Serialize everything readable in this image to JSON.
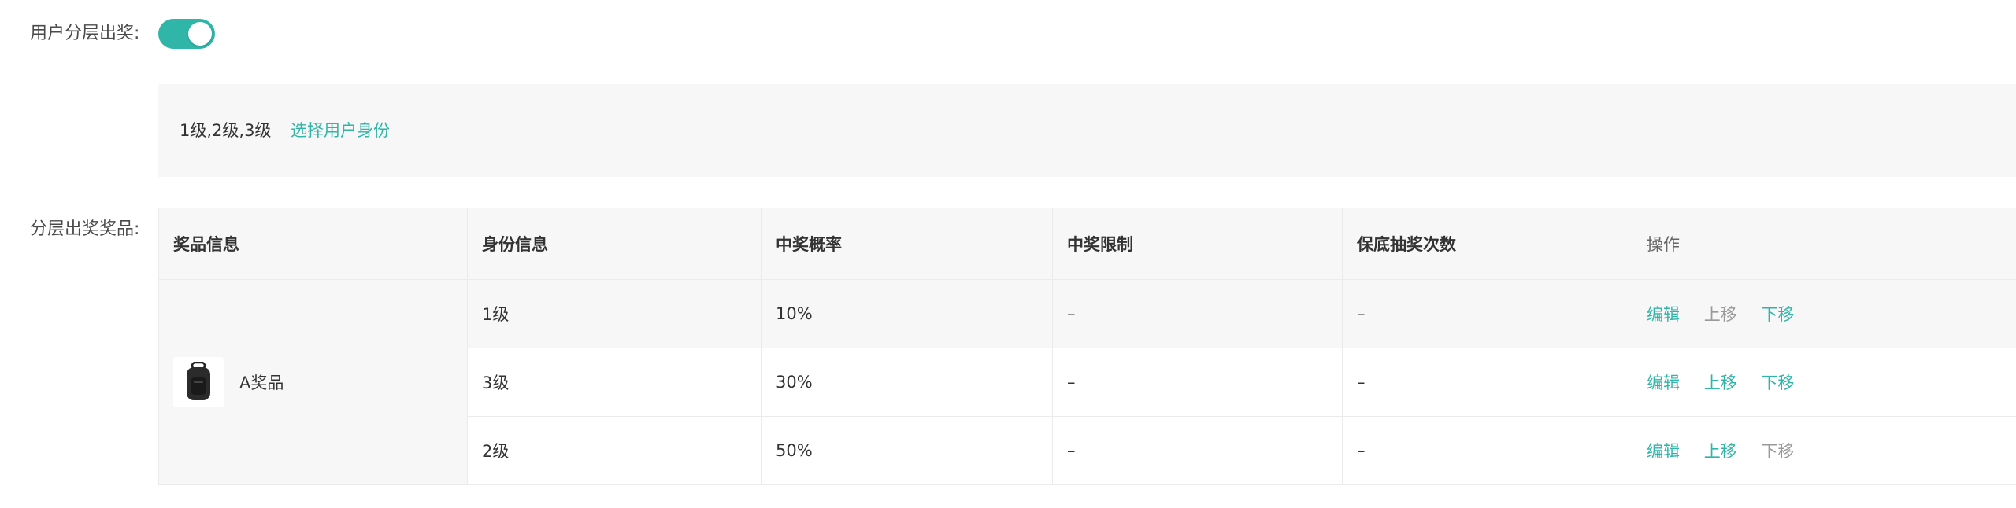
{
  "tiered_prize": {
    "label": "用户分层出奖:",
    "enabled": true
  },
  "identity": {
    "selected_values": "1级,2级,3级",
    "select_link": "选择用户身份"
  },
  "prize_section": {
    "label": "分层出奖奖品:",
    "columns": [
      "奖品信息",
      "身份信息",
      "中奖概率",
      "中奖限制",
      "保底抽奖次数",
      "操作"
    ],
    "prize_name": "A奖品",
    "prize_icon": "backpack-icon",
    "rows": [
      {
        "identity": "1级",
        "probability": "10%",
        "limit": "–",
        "guarantee": "–",
        "actions": [
          {
            "label": "编辑",
            "enabled": true
          },
          {
            "label": "上移",
            "enabled": false
          },
          {
            "label": "下移",
            "enabled": true
          }
        ]
      },
      {
        "identity": "3级",
        "probability": "30%",
        "limit": "–",
        "guarantee": "–",
        "actions": [
          {
            "label": "编辑",
            "enabled": true
          },
          {
            "label": "上移",
            "enabled": true
          },
          {
            "label": "下移",
            "enabled": true
          }
        ]
      },
      {
        "identity": "2级",
        "probability": "50%",
        "limit": "–",
        "guarantee": "–",
        "actions": [
          {
            "label": "编辑",
            "enabled": true
          },
          {
            "label": "上移",
            "enabled": true
          },
          {
            "label": "下移",
            "enabled": false
          }
        ]
      }
    ]
  },
  "colors": {
    "accent": "#2fb6a8",
    "disabled": "#999999",
    "panel_bg": "#f7f7f8",
    "border": "#ebebeb"
  }
}
